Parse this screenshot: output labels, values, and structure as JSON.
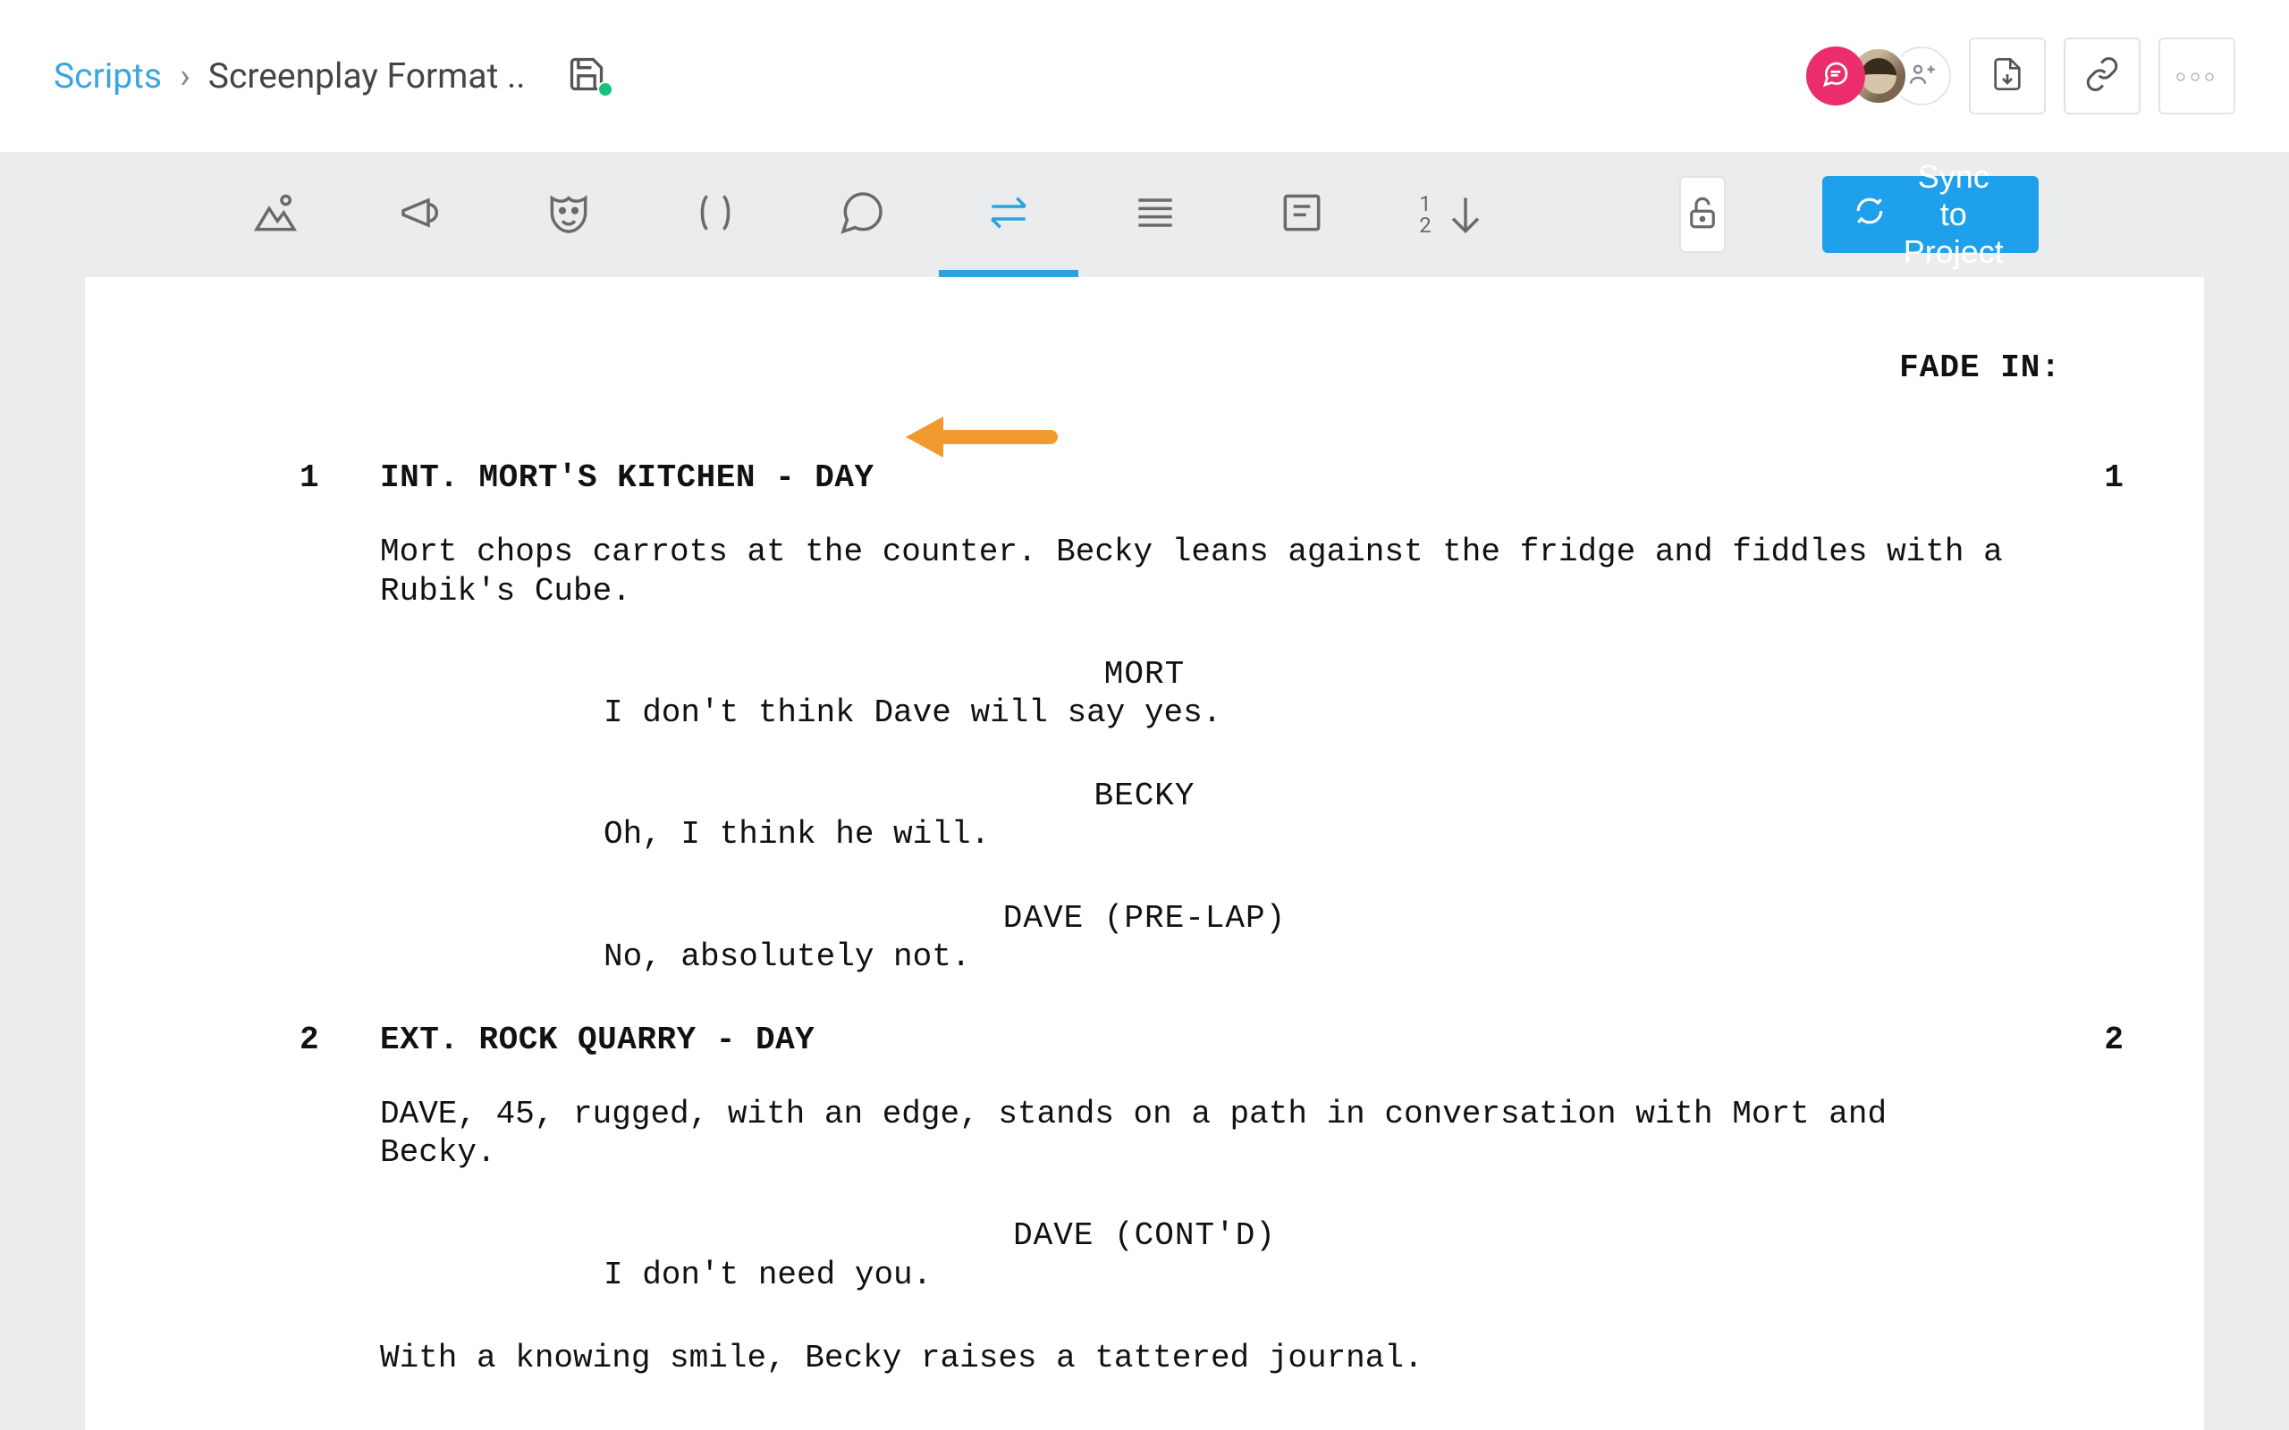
{
  "breadcrumb": {
    "root": "Scripts",
    "current": "Screenplay Format .."
  },
  "header": {
    "more_label": "◦◦◦"
  },
  "toolbar": {
    "number_1": "1",
    "number_2": "2",
    "sync_label": "Sync to Project"
  },
  "script": {
    "transition_in": "FADE IN:",
    "scenes": [
      {
        "number": "1",
        "heading": "INT. MORT'S KITCHEN - DAY",
        "action1": "Mort chops carrots at the counter. Becky leans against the fridge and fiddles with a Rubik's Cube.",
        "d1_char": "MORT",
        "d1_line": "I don't think Dave will say yes.",
        "d2_char": "BECKY",
        "d2_line": "Oh, I think he will.",
        "d3_char": "DAVE (PRE-LAP)",
        "d3_line": "No, absolutely not."
      },
      {
        "number": "2",
        "heading": "EXT. ROCK QUARRY - DAY",
        "action1": "DAVE, 45, rugged, with an edge, stands on a path in conversation with Mort and Becky.",
        "d1_char": "DAVE (CONT'D)",
        "d1_line": "I don't need you.",
        "action2": "With a knowing smile, Becky raises a tattered journal."
      }
    ]
  }
}
